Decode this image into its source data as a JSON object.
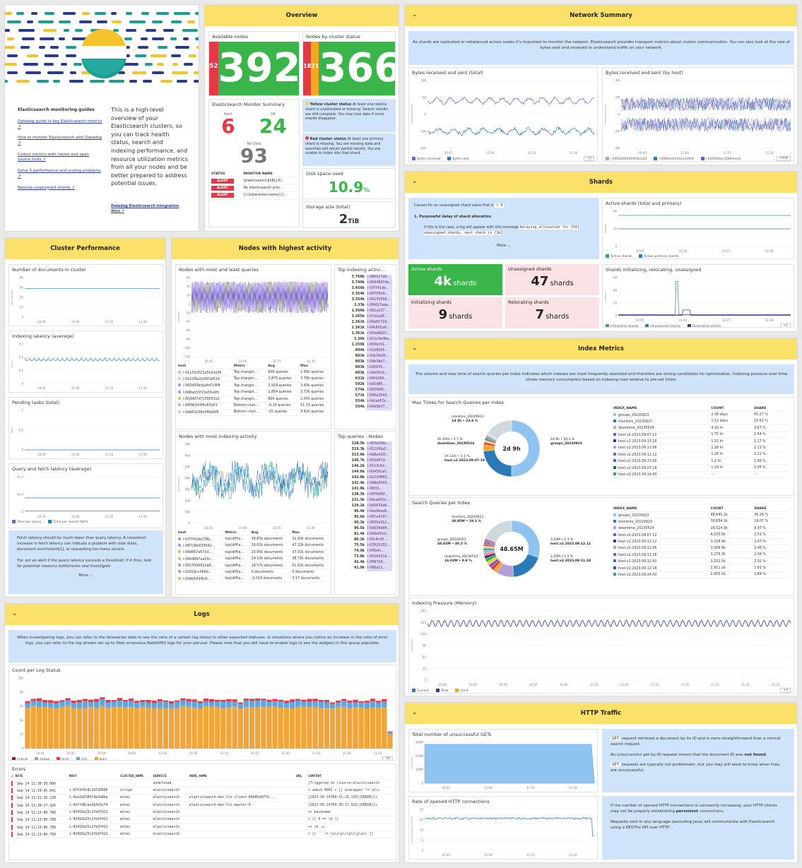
{
  "colors": {
    "header": "#fbe16a",
    "note": "#cfe4fa",
    "green": "#3ab54a",
    "red": "#e53947",
    "orange": "#f5a623",
    "yellow": "#f4d03f"
  },
  "about": {
    "guides_title": "Elasticsearch monitoring guides",
    "links": [
      "Datadog guide to key Elasticsearch metrics ↗",
      "How to monitor Elasticsearch with Datadog ↗",
      "Collect metrics with native and open source tools ↗",
      "Solve 5 performance and scaling problems ↗",
      "Resolve unassigned shards ↗"
    ],
    "description": "This is a high-level overview of your Elasticsearch clusters, so you can track health status, search and indexing performance, and resource utilization metrics from all your nodes and be better prepared to address potential issues.",
    "integration_link": "Datadog Elasticsearch integration docs ↗"
  },
  "overview": {
    "title": "Overview",
    "available_nodes": {
      "label": "Available nodes",
      "red": "52",
      "value": "392"
    },
    "nodes_by_status": {
      "label": "Nodes by cluster status",
      "red": "18",
      "orange": "21",
      "value": "366"
    },
    "yellow_note_title": "Yellow cluster status",
    "yellow_note": "At least one replica shard is unallocated or missing. Search results are still complete. You may lose data if more shards disappear.",
    "red_note_title": "Red cluster status",
    "red_note": "At least one primary shard is missing. You are missing data and searches will return partial results. You are unable to index into that shard.",
    "monitor": {
      "title": "Elasticsearch Monitor Summary",
      "alert_label": "Alert",
      "alert": "6",
      "ok_label": "OK",
      "ok": "24",
      "nodata_label": "No Data",
      "nodata": "93",
      "col_status": "STATUS",
      "col_name": "MONITOR NAME",
      "rows": [
        {
          "status": "ALERT",
          "name": "[elasticsearch][k8s] El..."
        },
        {
          "status": "ALERT",
          "name": "No elasticsearch proc..."
        },
        {
          "status": "ALERT",
          "name": "[{{datacenter.name}}]..."
        }
      ]
    },
    "disk": {
      "label": "Disk space used",
      "value": "10.9",
      "unit": "%"
    },
    "storage": {
      "label": "Storage size (total)",
      "value": "2",
      "unit": "TiB"
    }
  },
  "network": {
    "title": "Network Summary",
    "note": "As shards are replicated or rebalanced across nodes it's important to monitor the network. Elasticsearch provides transport metrics about cluster communication. You can also look at the rate of bytes sent and received to understand traffic on your network.",
    "left_title": "Bytes received and sent (total)",
    "left_ylabel": "Packets/second",
    "left_yticks": [
      "10K",
      "5K",
      "0",
      "-10K",
      "-20K"
    ],
    "left_xticks": [
      "10:45",
      "11:00",
      "11:15",
      "11:30"
    ],
    "left_legend": [
      "Bytes received",
      "Bytes sent"
    ],
    "left_more": "+2",
    "right_title": "Bytes received and sent (by host)",
    "right_ylabel": "Packets/second",
    "right_yticks": [
      "4M",
      "2M",
      "0",
      "-2M",
      "-4M"
    ],
    "right_legend": [
      "i-0002d4690285Sea33",
      "i-0009ec914a2a1d94f",
      "i-000d5bac3584feed3"
    ],
    "right_more": "+838"
  },
  "shards": {
    "title": "Shards",
    "note_intro": "Causes for an unassigned shard value that is",
    "note_code": "> 0",
    "note_item": "1. Purposeful delay of shard allocation",
    "note_text": "If this is the case, a log will appear with this message",
    "note_code2": "delaying allocation for [54] unassigned shards, next check in [1m]",
    "more": "More",
    "active_title": "Active shards (total and primary)",
    "active_ylabel": "Shards",
    "active_yticks": [
      "4k",
      "2k",
      "0"
    ],
    "active_legend": [
      "Active shards",
      "Active primary shards"
    ],
    "tiles": [
      {
        "label": "Active shards",
        "value": "4k",
        "unit": "shards"
      },
      {
        "label": "Unassigned shards",
        "value": "47",
        "unit": "shards"
      },
      {
        "label": "Initializing shards",
        "value": "9",
        "unit": "shards"
      },
      {
        "label": "Relocating shards",
        "value": "7",
        "unit": "shards"
      }
    ],
    "init_title": "Shards initializing, relocating, unassigned",
    "init_ylabel": "Shards",
    "init_yticks": [
      "60",
      "40",
      "20",
      "0"
    ],
    "init_legend": [
      "Initializing shards",
      "Unassigned shards",
      "Relocating shards"
    ],
    "init_more": "+1"
  },
  "cluster_perf": {
    "title": "Cluster Performance",
    "docs": {
      "title": "Number of documents in cluster",
      "ylabel": "Documents",
      "yticks": [
        "4G",
        "3G",
        "2G",
        "1G",
        "0"
      ]
    },
    "latency": {
      "title": "Indexing latency (average)",
      "ylabel": "Hours",
      "yticks": [
        "0.3",
        "0.2",
        "0.1",
        "0"
      ]
    },
    "pending": {
      "title": "Pending tasks (total)",
      "ylabel": "Tasks",
      "yticks": [
        "1",
        "0.5",
        "0"
      ]
    },
    "fetch": {
      "title": "Query and fetch latency (average)",
      "yticks": [
        "1e-3",
        "5e-4",
        "0"
      ],
      "legend": [
        "Time per query",
        "Time per search fetch"
      ]
    },
    "xticks": [
      "10:45",
      "11:00",
      "11:15",
      "11:30"
    ],
    "note": "Fetch latency should be much lower than query latency. A consistent increase in fetch latency can indicate a problem with slow disks, document enrichment[1], or requesting too many results.",
    "tip": "Tip: set an alert if the query latency exceeds a threshold. If it fires, look for potential resource bottlenecks and investigate",
    "more": "More"
  },
  "nodes_activity": {
    "title": "Nodes with highest activity",
    "queries": {
      "title": "Nodes with most and least queries",
      "ylabel": "Queries",
      "yticks": [
        "6k",
        "4k",
        "2k",
        "0",
        "-2k",
        "-4k",
        "-6k",
        "-8k",
        "-10k",
        "-12k"
      ],
      "xticks": [
        "10:45",
        "11:00",
        "11:15",
        "11:30"
      ],
      "cols": [
        "host",
        "Metric",
        "Avg",
        "Max"
      ],
      "rows": [
        [
          "i-01133c621a31d2a36",
          "Top changin...",
          "806 queries",
          "1.95k queries"
        ],
        [
          "i-0122f6a2a587af519",
          "Top changin...",
          "2,875 queries",
          "3.78k queries"
        ],
        [
          "i-065b00bcba4d7c4f8",
          "Top changin...",
          "2,918 queries",
          "3.83k queries"
        ],
        [
          "i-0d8ad15f15e55a9fc",
          "Top changin...",
          "2,854 queries",
          "3.73k queries"
        ],
        [
          "i-0f2b6f7d7c59553a1",
          "Top changin...",
          "805 queries",
          "2.07k queries"
        ],
        [
          "i-04f9b543f6c67a01",
          "Bottom chan...",
          "-0.29 queries",
          "51.33 queries"
        ],
        [
          "i-0ab63108e3ffbe0f9",
          "Bottom chan...",
          "-25 queries",
          "4.42k queries"
        ]
      ]
    },
    "top_indexing": {
      "title": "Top indexing activi...",
      "rows": [
        [
          "3.768k",
          "i-08d157a8..."
        ],
        [
          "3.749k",
          "i-09449974a..."
        ],
        [
          "3.456k",
          "i-07f741da..."
        ],
        [
          "3.354k",
          "i-087f0fe9..."
        ],
        [
          "3.354k",
          "i-09235958..."
        ],
        [
          "3.33k",
          "i-0fb627aaa..."
        ],
        [
          "1.366k",
          "i-061a237..."
        ],
        [
          "1.365k",
          "i-07a2ad6..."
        ],
        [
          "1.361k",
          "i-00e65719..."
        ],
        [
          "1.361k",
          "i-04c601a0..."
        ],
        [
          "1.361k",
          "i-01ba6922..."
        ],
        [
          "1.36k",
          "i-012c0e08a..."
        ],
        [
          "1.359k",
          "i-000bc51..."
        ],
        [
          "804k",
          "i-02d65b5..."
        ],
        [
          "803k",
          "i-0d10fe05..."
        ],
        [
          "803k",
          "i-04b3bb7..."
        ],
        [
          "803k",
          "i-0d5635..."
        ],
        [
          "803k",
          "i-0de00cb..."
        ],
        [
          "631k",
          "i-06fd164..."
        ],
        [
          "592k",
          "i-0a5d86..."
        ],
        [
          "574k",
          "i-097fb65..."
        ],
        [
          "571k",
          "i-098a3543..."
        ],
        [
          "554k",
          "i-0dcab53c..."
        ],
        [
          "554k",
          "i-04d3b07..."
        ]
      ]
    },
    "indexing": {
      "title": "Nodes with most indexing activity",
      "ylabel": "Documents",
      "yticks": [
        "70k",
        "60k",
        "50k",
        "40k",
        "30k",
        "20k",
        "10k",
        "0"
      ],
      "xticks": [
        "10:45",
        "11:00",
        "11:15",
        "11:30"
      ],
      "cols": [
        "host",
        "Metric",
        "Avg",
        "Max"
      ],
      "rows": [
        [
          "i-07f741da278b...",
          "top(diff(a...",
          "18.83k documents",
          "31.42k documents"
        ],
        [
          "i-087c9fe039542...",
          "top(diff(a...",
          "18.61k documents",
          "47.32k documents"
        ],
        [
          "i-08d667a673d...",
          "top(diff(a...",
          "20.95k documents",
          "37.01k documents"
        ],
        [
          "i-0904897aa20c...",
          "top(diff(a...",
          "19.10k documents",
          "38.72k documents"
        ],
        [
          "i-0923595820a8...",
          "top(diff(a...",
          "18.57k documents",
          "51.62k documents"
        ],
        [
          "i-02916cc066d...",
          "top(diff(a...",
          "0 documents",
          "0 documents"
        ],
        [
          "i-049b543f6c6...",
          "top(diff(a...",
          "-0.018 documents",
          "3.17 documents"
        ]
      ]
    },
    "top_queries": {
      "title": "Top queries - Nodes",
      "rows": [
        [
          "328.5k",
          "i-065b00bc..."
        ],
        [
          "319.3k",
          "i-0122f6a2..."
        ],
        [
          "313.6k",
          "i-0d8ad15f..."
        ],
        [
          "146.7k",
          "i-0f2b6f7d..."
        ],
        [
          "146.2k",
          "i-0113c62..."
        ],
        [
          "144.6k",
          "i-004591ef..."
        ],
        [
          "142.8k",
          "i-0122f4f62..."
        ],
        [
          "142.4k",
          "i-098a3543..."
        ],
        [
          "141.8k",
          "i-06fd1..."
        ],
        [
          "138.3k",
          "i-097fb65f..."
        ],
        [
          "131.3k",
          "i-0dcab53c..."
        ],
        [
          "129.2k",
          "i-0d5635a8..."
        ],
        [
          "96.4k",
          "i-0ee4bea8..."
        ],
        [
          "95.6k",
          "i-097e4197..."
        ],
        [
          "95.3k",
          "i-0835e512..."
        ],
        [
          "90.5k",
          "i-0d939a94..."
        ],
        [
          "81.4k",
          "i-0e6ef91d..."
        ],
        [
          "80.2k",
          "i-05c4c43..."
        ],
        [
          "75.5k",
          "i-07823255..."
        ],
        [
          "74.9k",
          "i-045efc..."
        ],
        [
          "72.8k",
          "i-0010d21d..."
        ],
        [
          "42.4k",
          "i-0ff97d9..."
        ],
        [
          "41.9k",
          "i-098a12..."
        ]
      ]
    }
  },
  "index_metrics": {
    "title": "Index Metrics",
    "note": "The volume and max time of search queries per index indicates which indexes are most frequently searched and therefore are strong candidates for optimization. Indexing pressure over time shows memory consumption based on indexing load relative to pre-set limits.",
    "max_times": {
      "title": "Max Times for Search Queries per Index",
      "center": "2d 9h",
      "labels": [
        "monitors_20220923",
        "1d 3h • 23.6 %",
        "4h 10m • 3.7 %",
        "downtime_20230524",
        "1h 12m • 1.1 %",
        "host.v2.2023.09.07.18",
        "2d 9h • 50.3 %",
        "groups_20220923"
      ],
      "cols": [
        "INDEX_NAME",
        "COUNT",
        "SHARE"
      ],
      "rows": [
        [
          "groups_20220923",
          "2.38 days",
          "50.27 %"
        ],
        [
          "monitors_20220923",
          "1.12 days",
          "23.62 %"
        ],
        [
          "downtime_20230524",
          "4.16 hr",
          "3.67 %"
        ],
        [
          "host.v2.2023.09.07.12",
          "1.75 hr",
          "1.54 %"
        ],
        [
          "host.v2.2023.09.13.18",
          "1.32 hr",
          "1.17 %"
        ],
        [
          "host.v2.2023.09.12.06",
          "1.28 hr",
          "1.13 %"
        ],
        [
          "host.v2.2023.09.12.12",
          "1.26 hr",
          "1.11 %"
        ],
        [
          "host.v2.2023.09.13.06",
          "1.2 hr",
          "1.06 %"
        ],
        [
          "host.v2.2023.09.07.18",
          "1.19 hr",
          "1.05 %"
        ],
        [
          "host.v2.2023.09.14.00",
          "...",
          "..."
        ]
      ]
    },
    "search_queries": {
      "title": "Search Queries per Index",
      "center": "48.65M",
      "labels": [
        "monitors_20220923",
        "30.85M • 19.1 %",
        "groups_20220923",
        "48.65M • 30.3 %",
        "downtime_20230524",
        "16.02M • 9.9 %",
        "3.33M • 2.1 %",
        "host.v2.2023.09.12.12",
        "2.35M • 1.5 %",
        "host.v2.2023.09.11.18"
      ],
      "cols": [
        "INDEX_NAME",
        "COUNT",
        "SHARE"
      ],
      "rows": [
        [
          "groups_20220923",
          "48,645.2k",
          "30.26 %"
        ],
        [
          "monitors_20220923",
          "30,654.2k",
          "19.07 %"
        ],
        [
          "downtime_20230524",
          "16,024.9k",
          "9.97 %"
        ],
        [
          "host.v2.2023.09.07.12",
          "4,033.5k",
          "2.51 %"
        ],
        [
          "host.v2.2023.09.12.12",
          "3,328.4k",
          "2.07 %"
        ],
        [
          "host.v2.2023.09.12.06",
          "3,306.9k",
          "2.06 %"
        ],
        [
          "host.v2.2023.09.13.18",
          "3,276.3k",
          "2.04 %"
        ],
        [
          "host.v2.2023.09.12.00",
          "3,252.5k",
          "2.02 %"
        ],
        [
          "host.v2.2023.09.12.18",
          "2,911.2k",
          "1.81 %"
        ],
        [
          "host.v2.2023.09.14.00",
          "2,955.1k",
          "1.84 %"
        ]
      ]
    },
    "pressure": {
      "title": "Indexing Pressure (Memory)",
      "ylabel": "Gibibytes",
      "yticks": [
        "192",
        "160",
        "128",
        "96",
        "64",
        "32",
        "0"
      ],
      "xticks": [
        "10:40",
        "10:45",
        "10:50",
        "10:55",
        "11:00",
        "11:05",
        "11:10",
        "11:15",
        "11:20",
        "11:25",
        "11:30",
        "11:35"
      ],
      "legend": [
        "Current",
        "Total",
        "Limit"
      ],
      "more": "+3"
    }
  },
  "logs": {
    "title": "Logs",
    "note": "When investigating logs, you can refer to the timeseries data to see the ratio of a certain log status to other expected statuses. In situations where you notice an increase in the ratio of error logs, you can refer to the log stream set up to filter erroneous RabbitMQ logs for your perusal. Please note that you will have to enable logs to see the widgets in this group populate.",
    "count_title": "Count per Log Status",
    "yticks": [
      "10k",
      "8k",
      "6k",
      "4k",
      "2k",
      "0"
    ],
    "xticks": [
      "10:40",
      "10:45",
      "10:50",
      "10:55",
      "11:00",
      "11:05",
      "11:10",
      "11:15",
      "11:20",
      "11:25",
      "11:30",
      "11:35"
    ],
    "legend": [
      "critical",
      "debug",
      "error",
      "info",
      "warn"
    ],
    "more": "+6",
    "errors_title": "Errors",
    "cols": [
      "DATE",
      "HOST",
      "CLUSTER_NAME",
      "SERVICE",
      "NODE_NAME",
      "URL",
      "CONTENT"
    ],
    "rows": [
      [
        "Sep 14 11:38:30.000",
        "",
        "",
        "undefined",
        "",
        "",
        "[Triggered on {source:elasticsearch"
      ],
      [
        "Sep 14 11:34:45.041",
        "i-07f4f0c8c19720406",
        "stripe",
        "elasticsearch",
        "",
        "",
        "+ umask 0002 + [] esmrapper != \\e\\s"
      ],
      [
        "Sep 14 11:31:26.139",
        "i-0ea3a538974a3a8ba",
        "entei",
        "elasticsearch",
        "elasticsearch-dev-tls-client-84d85d477d...",
        "",
        "[2023-09-14T09:31:26,139][ERROR][c"
      ],
      [
        "Sep 14 11:30:17.926",
        "i-0e7fd8caa16425ef4",
        "entei",
        "elasticsearch",
        "elasticsearch-dev-tls-master-0",
        "",
        "[2023-09-14T09:30:17,926][ERROR][c"
      ],
      [
        "Sep 14 11:23:00.708",
        "i-83416e25c2fb3f422",
        "entei",
        "elasticsearch",
        "",
        "",
        "++ basename"
      ],
      [
        "Sep 14 11:23:00.708",
        "i-83416e25c2fb3f422",
        "entei",
        "elasticsearch",
        "",
        "",
        "+ [[ 0 == \\0 ]]"
      ],
      [
        "Sep 14 11:23:00.708",
        "i-83416e25c2fb3f422",
        "entei",
        "elasticsearch",
        "",
        "",
        "++ id -u"
      ],
      [
        "Sep 14 11:23:00.708",
        "i-83416e25c2fb3f422",
        "entei",
        "elasticsearch",
        "",
        "",
        "+ [[ `` != \\e\\s\\e\\r\\p\\l\\p\\e\\r ]]"
      ]
    ]
  },
  "http": {
    "title": "HTTP Traffic",
    "gets_title": "Total number of unsuccessful GETs",
    "gets_ylabel": "Requests",
    "gets_yticks": [
      "300M",
      "200M",
      "100M",
      "0"
    ],
    "note1a": "request retrieves a document by its ID and is more straightforward than a normal search request.",
    "note1_code": "GET",
    "note1b": "An unsuccessful get-by-ID request means that the document ID was",
    "note1_bold": "not found",
    "note1c": "requests are typically not problematic, but you may still want to know when they are unsuccessful.",
    "conn_title": "Rate of opened HTTP connections",
    "conn_ylabel": "Connections/second",
    "conn_yticks": [
      "20",
      "15",
      "10",
      "5",
      "0"
    ],
    "note2a": "If the number of opened HTTP connections is constantly increasing, your HTTP clients may not be properly establishing",
    "note2_bold": "persistent",
    "note2b": "connections.",
    "note2c": "Requests sent in any language (excluding Java) will communicate with Elasticsearch using a RESTful API over HTTP.",
    "xticks": [
      "10:45",
      "11:00",
      "11:15",
      "11:30"
    ]
  }
}
